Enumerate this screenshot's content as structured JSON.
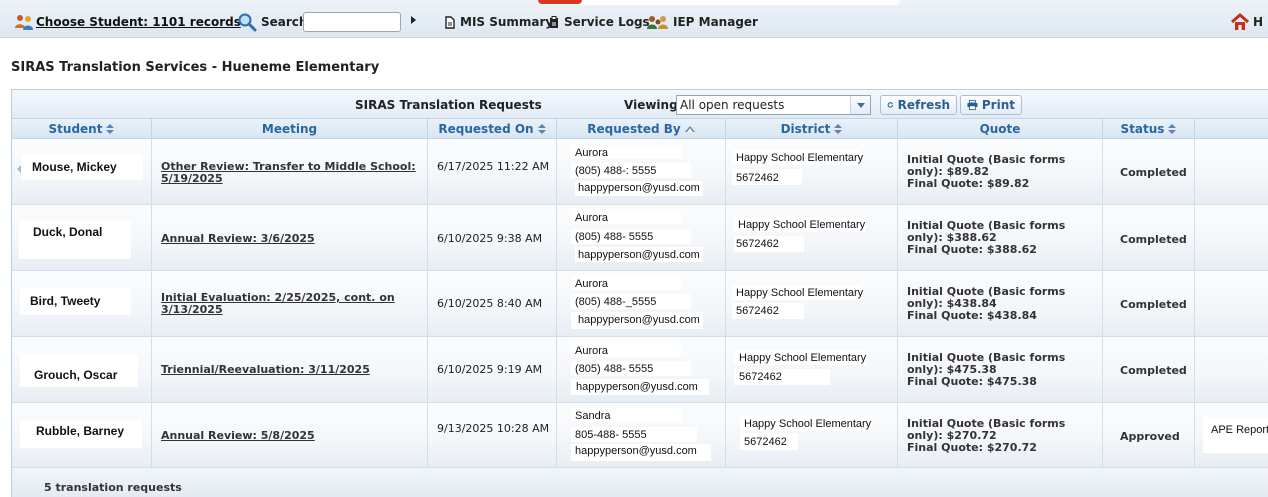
{
  "nav": {
    "choose_student": "Choose Student: 1101 records",
    "search_label": "Search",
    "search_value": "",
    "mis_summary": "MIS Summary",
    "service_logs": "Service Logs",
    "iep_manager": "IEP Manager",
    "home_label": "H"
  },
  "page_title": "SIRAS Translation Services - Hueneme Elementary",
  "panel": {
    "title": "SIRAS Translation Requests",
    "viewing_label": "Viewing:",
    "viewing_value": "All open requests",
    "refresh_label": "Refresh",
    "print_label": "Print"
  },
  "columns": {
    "student": "Student",
    "meeting": "Meeting",
    "requested_on": "Requested On",
    "requested_by": "Requested By",
    "district": "District",
    "quote": "Quote",
    "status": "Status"
  },
  "rows": [
    {
      "student": "Mouse, Mickey",
      "meeting": "Other Review: Transfer to Middle School: 5/19/2025",
      "requested_on": "6/17/2025 11:22 AM",
      "by_name": "Aurora",
      "by_phone": "(805) 488-: 5555",
      "by_email": "happyperson@yusd.com",
      "district_name": "Happy School Elementary",
      "district_code": "5672462",
      "quote_initial": "Initial Quote (Basic forms only): $89.82",
      "quote_final": "Final Quote: $89.82",
      "status": "Completed",
      "extra": ""
    },
    {
      "student": "Duck, Donal",
      "meeting": "Annual Review: 3/6/2025",
      "requested_on": "6/10/2025 9:38 AM",
      "by_name": "Aurora",
      "by_phone": "(805) 488-  5555",
      "by_email": "happyperson@yusd.com",
      "district_name": "Happy School Elementary",
      "district_code": "5672462",
      "quote_initial": "Initial Quote (Basic forms only): $388.62",
      "quote_final": "Final Quote: $388.62",
      "status": "Completed",
      "extra": ""
    },
    {
      "student": "Bird, Tweety",
      "meeting": "Initial Evaluation: 2/25/2025, cont. on 3/13/2025",
      "requested_on": "6/10/2025 8:40 AM",
      "by_name": "Aurora",
      "by_phone": "(805) 488-_5555",
      "by_email": "happyperson@yusd.com",
      "district_name": "Happy School Elementary",
      "district_code": "5672462",
      "quote_initial": "Initial Quote (Basic forms only): $438.84",
      "quote_final": "Final Quote: $438.84",
      "status": "Completed",
      "extra": ""
    },
    {
      "student": "Grouch, Oscar",
      "meeting": "Triennial/Reevaluation: 3/11/2025",
      "requested_on": "6/10/2025 9:19 AM",
      "by_name": "Aurora",
      "by_phone": "(805) 488-  5555",
      "by_email": "happyperson@yusd.com",
      "district_name": "Happy School Elementary",
      "district_code": "5672462",
      "quote_initial": "Initial Quote (Basic forms only): $475.38",
      "quote_final": "Final Quote: $475.38",
      "status": "Completed",
      "extra": ""
    },
    {
      "student": "Rubble, Barney",
      "meeting": "Annual Review: 5/8/2025",
      "requested_on": "9/13/2025 10:28 AM",
      "by_name": "Sandra",
      "by_phone": "805-488-  5555",
      "by_email": "happyperson@yusd.com",
      "district_name": "Happy School Elementary",
      "district_code": "5672462",
      "quote_initial": "Initial Quote (Basic forms only): $270.72",
      "quote_final": "Final Quote: $270.72",
      "status": "Approved",
      "extra": "APE Report"
    }
  ],
  "footer": {
    "count_text": "5 translation requests"
  },
  "colors": {
    "link_blue": "#2a66a3",
    "header_bg": "#dde7f1",
    "border": "#c4d6e6"
  }
}
